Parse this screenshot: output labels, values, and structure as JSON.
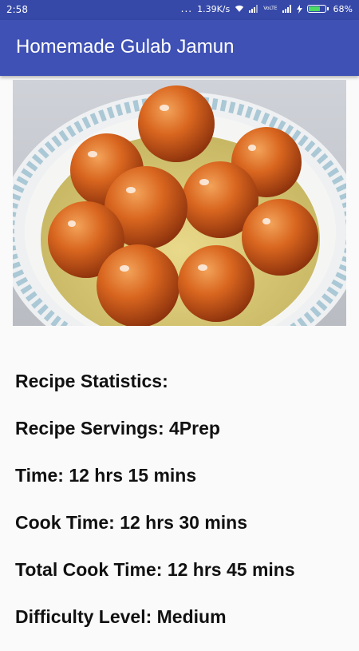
{
  "status_bar": {
    "time": "2:58",
    "dots": "...",
    "network_speed": "1.39K/s",
    "lte_label": "VoLTE",
    "battery_percent": "68%",
    "battery_level": 0.68
  },
  "app_bar": {
    "title": "Homemade Gulab Jamun"
  },
  "recipe": {
    "image_icon": "gulab-jamun-photo",
    "stats": [
      "Recipe Statistics:",
      "Recipe Servings: 4Prep",
      "Time: 12 hrs 15 mins",
      "Cook Time: 12 hrs 30 mins",
      "Total Cook Time: 12 hrs 45 mins",
      "Difficulty Level: Medium"
    ]
  },
  "colors": {
    "status_bar": "#3649a8",
    "app_bar": "#3f51b5",
    "background": "#fafafa",
    "text": "#111111"
  }
}
